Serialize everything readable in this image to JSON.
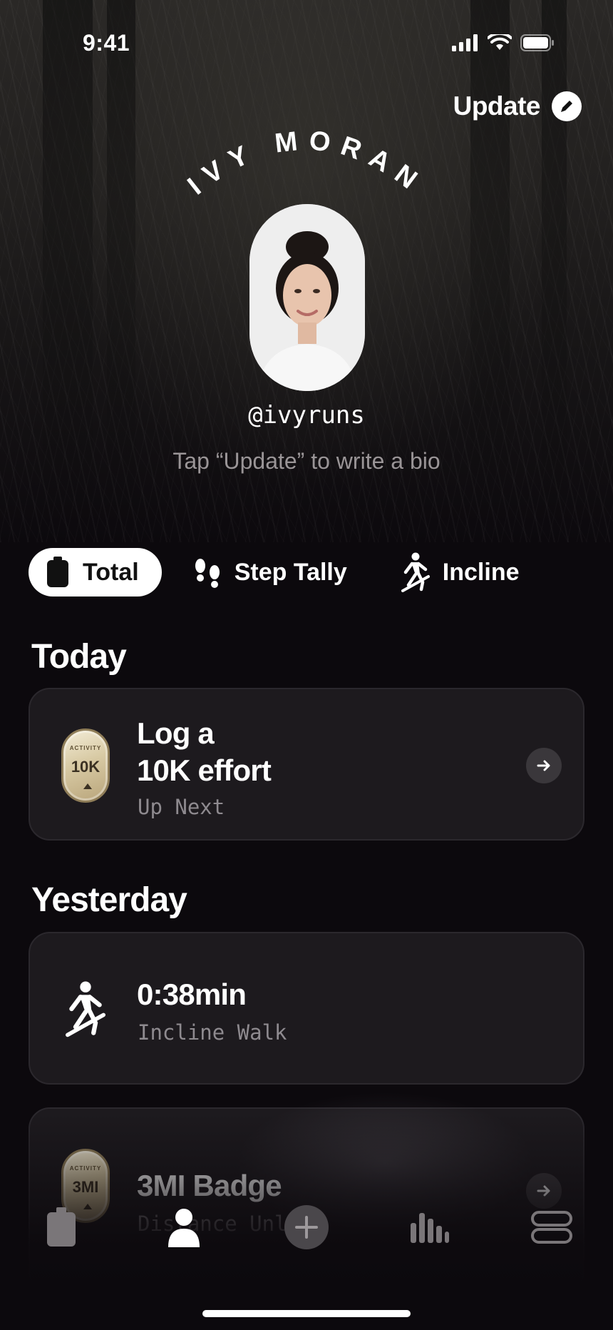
{
  "status_bar": {
    "time": "9:41"
  },
  "header": {
    "update_label": "Update",
    "display_name": "IVY MORAN",
    "handle": "@ivyruns",
    "bio_hint": "Tap “Update” to write a bio"
  },
  "tabs": [
    {
      "label": "Total",
      "icon": "phone-icon",
      "active": true
    },
    {
      "label": "Step Tally",
      "icon": "footprints-icon",
      "active": false
    },
    {
      "label": "Incline",
      "icon": "hiker-icon",
      "active": false
    }
  ],
  "sections": {
    "today": {
      "title": "Today",
      "card": {
        "badge_top": "ACTIVITY",
        "badge_main": "10K",
        "title_line1": "Log a",
        "title_line2": "10K effort",
        "subtitle": "Up Next"
      }
    },
    "yesterday": {
      "title": "Yesterday",
      "cards": [
        {
          "title": "0:38min",
          "subtitle": "Incline Walk",
          "icon": "hiker-icon"
        },
        {
          "badge_top": "ACTIVITY",
          "badge_main": "3MI",
          "title": "3MI Badge",
          "subtitle": "Distance Unlock"
        }
      ]
    }
  },
  "bottom_nav": {
    "items": [
      {
        "name": "phone-icon",
        "active": false
      },
      {
        "name": "profile-icon",
        "active": true
      },
      {
        "name": "add-icon",
        "active": false
      },
      {
        "name": "stats-icon",
        "active": false
      },
      {
        "name": "settings-toggle-icon",
        "active": false
      }
    ]
  },
  "colors": {
    "background": "#0c090d",
    "card": "#1d1a1e",
    "muted_text": "#8e8a8f",
    "badge_gold": "#d8caa4"
  }
}
